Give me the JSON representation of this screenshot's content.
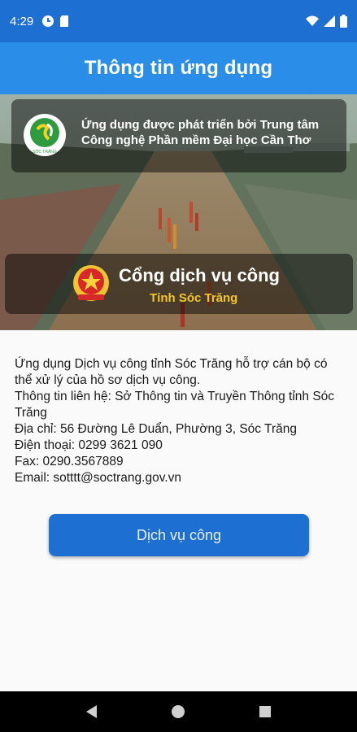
{
  "status_bar": {
    "time": "4:29"
  },
  "app_bar": {
    "title": "Thông tin ứng dụng"
  },
  "hero": {
    "developer_text": "Ứng dụng được phát triển bởi Trung tâm Công nghệ Phần mềm Đại học Cần Thơ",
    "portal_title": "Cổng dịch vụ công",
    "portal_subtitle": "Tỉnh Sóc Trăng",
    "logo_text": "SÓC TRĂNG"
  },
  "info": {
    "description": "Ứng dụng Dịch vụ công tỉnh Sóc Trăng hỗ trợ cán bộ có thể xử lý của hồ sơ dịch vụ công.",
    "contact": "Thông tin liên hệ: Sở Thông tin và Truyền Thông tỉnh Sóc Trăng",
    "address_label": "Địa chỉ:",
    "address_value": "56 Đường Lê Duẩn, Phường 3, Sóc Trăng",
    "phone": "Điện thoại: 0299 3621 090",
    "fax": "Fax: 0290.3567889",
    "email": "Email: sotttt@soctrang.gov.vn"
  },
  "actions": {
    "service_button": "Dịch vụ công"
  },
  "colors": {
    "status_bar": "#1e6fd2",
    "app_bar": "#2a8ee8",
    "button": "#1e6fd2",
    "subtitle_gold": "#f3c62a"
  },
  "icons": {
    "status_left": [
      "settings-app-icon",
      "sd-card-icon"
    ],
    "status_right": [
      "wifi-icon",
      "signal-icon",
      "battery-icon"
    ],
    "nav": [
      "back-icon",
      "home-icon",
      "recents-icon"
    ]
  }
}
